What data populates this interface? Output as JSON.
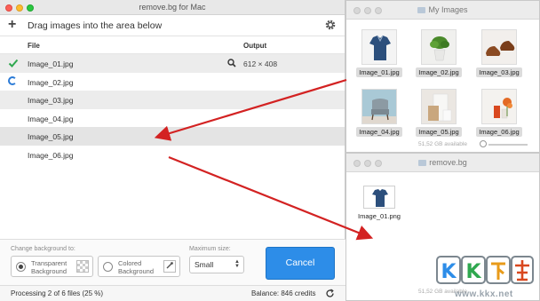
{
  "app": {
    "title": "remove.bg for Mac",
    "toolbar_title": "Drag images into the area below",
    "columns": {
      "file": "File",
      "output": "Output"
    },
    "files": [
      {
        "name": "Image_01.jpg",
        "status": "done",
        "output": "612 × 408"
      },
      {
        "name": "Image_02.jpg",
        "status": "processing",
        "output": ""
      },
      {
        "name": "Image_03.jpg",
        "status": "queued",
        "output": ""
      },
      {
        "name": "Image_04.jpg",
        "status": "queued",
        "output": ""
      },
      {
        "name": "Image_05.jpg",
        "status": "queued",
        "output": ""
      },
      {
        "name": "Image_06.jpg",
        "status": "queued",
        "output": ""
      }
    ],
    "change_bg_label": "Change background to:",
    "transparent": {
      "line1": "Transparent",
      "line2": "Background"
    },
    "colored": {
      "line1": "Colored",
      "line2": "Background"
    },
    "max_size_label": "Maximum size:",
    "max_size_value": "Small",
    "cancel_label": "Cancel",
    "status_text": "Processing 2 of 6 files (25 %)",
    "balance_text": "Balance: 846 credits"
  },
  "finder_top": {
    "title": "My Images",
    "items": [
      "Image_01.jpg",
      "Image_02.jpg",
      "Image_03.jpg",
      "Image_04.jpg",
      "Image_05.jpg",
      "Image_06.jpg"
    ],
    "available": "51,52 GB available"
  },
  "finder_bottom": {
    "title": "remove.bg",
    "items": [
      "Image_01.png"
    ],
    "available": "51,52 GB available"
  },
  "watermark": {
    "url": "www.kkx.net"
  },
  "colors": {
    "accent": "#2d8de8",
    "arrow": "#d32222",
    "check": "#2fa84f"
  }
}
